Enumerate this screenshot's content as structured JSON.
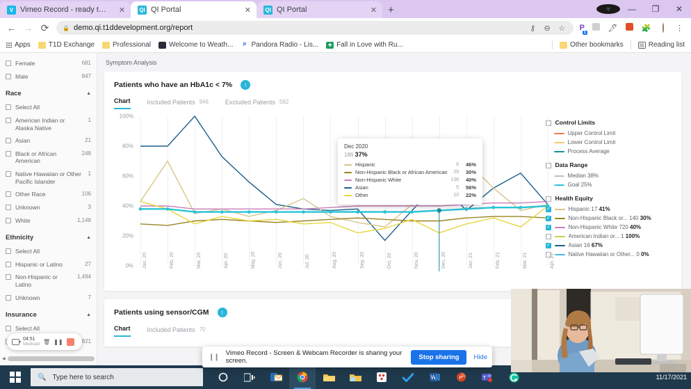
{
  "browser": {
    "tabs": [
      {
        "title": "Vimeo Record - ready to record",
        "favicon": "vimeo-icon",
        "active": false
      },
      {
        "title": "QI Portal",
        "favicon": "qi-icon",
        "active": true
      },
      {
        "title": "QI Portal",
        "favicon": "qi-icon",
        "active": false
      }
    ],
    "new_tab_label": "+",
    "close_label": "✕",
    "window_controls": {
      "minimize": "—",
      "maximize": "❐",
      "close": "✕"
    },
    "nav": {
      "back": "←",
      "forward": "→",
      "reload": "⟳"
    },
    "url": "demo.qi.t1ddevelopment.org/report",
    "url_host": "demo.qi.t1ddevelopment.org",
    "url_path": "/report",
    "lock_icon": "🔒",
    "toolbar_icons": [
      "key-icon",
      "zoom-out-icon",
      "star-icon",
      "password-manager-icon",
      "screenshot-icon",
      "highlighter-icon",
      "reader-icon",
      "extensions-icon",
      "profile-avatar",
      "menu-icon"
    ],
    "extension_badge": "1",
    "bookmarks": [
      {
        "label": "Apps",
        "icon": "apps-grid-icon"
      },
      {
        "label": "T1D Exchange",
        "icon": "folder-icon"
      },
      {
        "label": "Professional",
        "icon": "folder-icon"
      },
      {
        "label": "Welcome to Weath...",
        "icon": "weather-icon"
      },
      {
        "label": "Pandora Radio - Lis...",
        "icon": "pandora-icon"
      },
      {
        "label": "Fall in Love with Ru...",
        "icon": "sheets-icon"
      }
    ],
    "other_bookmarks": "Other bookmarks",
    "reading_list": "Reading list"
  },
  "sidebar": {
    "gender_items": [
      {
        "label": "Female",
        "count": "681",
        "checked": false
      },
      {
        "label": "Male",
        "count": "847",
        "checked": false
      }
    ],
    "sections": [
      {
        "title": "Race",
        "collapse_icon": "chevron-up-icon",
        "items": [
          {
            "label": "Select All",
            "count": "",
            "checked": false
          },
          {
            "label": "American Indian or Alaska Native",
            "count": "1",
            "checked": false
          },
          {
            "label": "Asian",
            "count": "21",
            "checked": false
          },
          {
            "label": "Black or African American",
            "count": "248",
            "checked": false
          },
          {
            "label": "Native Hawaiian or Other Pacific Islander",
            "count": "1",
            "checked": false
          },
          {
            "label": "Other Race",
            "count": "106",
            "checked": false
          },
          {
            "label": "Unknown",
            "count": "3",
            "checked": false
          },
          {
            "label": "White",
            "count": "1,148",
            "checked": false
          }
        ]
      },
      {
        "title": "Ethnicity",
        "collapse_icon": "chevron-up-icon",
        "items": [
          {
            "label": "Select All",
            "count": "",
            "checked": false
          },
          {
            "label": "Hispanic or Latino",
            "count": "27",
            "checked": false
          },
          {
            "label": "Non-Hispanic or Latino",
            "count": "1,494",
            "checked": false
          },
          {
            "label": "Unknown",
            "count": "7",
            "checked": false
          }
        ]
      },
      {
        "title": "Insurance",
        "collapse_icon": "chevron-up-icon",
        "items": [
          {
            "label": "Select All",
            "count": "",
            "checked": false
          },
          {
            "label": "Medicaid",
            "count": "821",
            "checked": false
          }
        ]
      }
    ],
    "recorder": {
      "camera_icon": "camera-icon",
      "time": "04:51",
      "sublabel": "Medicaid",
      "delete_icon": "trash-icon",
      "pause_icon": "pause-icon",
      "stop_icon": "stop-icon"
    },
    "scroll_left_icon": "scroll-left-arrow"
  },
  "main": {
    "breadcrumb": "Symptom Analysis",
    "card1": {
      "title": "Patients who have an HbA1c < 7%",
      "trend_icon": "arrow-up-badge",
      "tabs": [
        {
          "label": "Chart",
          "count": "",
          "active": true
        },
        {
          "label": "Included Patients",
          "count": "946",
          "active": false
        },
        {
          "label": "Excluded Patients",
          "count": "582",
          "active": false
        }
      ]
    },
    "card2": {
      "title": "Patients using sensor/CGM",
      "trend_icon": "arrow-up-badge",
      "tabs": [
        {
          "label": "Chart",
          "count": "",
          "active": true
        },
        {
          "label": "Included Patients",
          "count": "70",
          "active": false
        }
      ]
    }
  },
  "tooltip": {
    "date": "Dec 2020",
    "total_n": "186",
    "total_pct": "37%",
    "rows": [
      {
        "color": "#d8c58a",
        "name": "Hispanic",
        "n": "6",
        "pct": "46%"
      },
      {
        "color": "#9a8422",
        "name": "Non-Hispanic Black or African American",
        "n": "29",
        "pct": "30%"
      },
      {
        "color": "#c97db8",
        "name": "Non-Hispanic White",
        "n": "138",
        "pct": "40%"
      },
      {
        "color": "#1a5e8a",
        "name": "Asian",
        "n": "5",
        "pct": "56%"
      },
      {
        "color": "#e8d63c",
        "name": "Other",
        "n": "10",
        "pct": "22%"
      }
    ]
  },
  "legend": {
    "groups": [
      {
        "title": "Control Limits",
        "checked": false,
        "items": [
          {
            "label": "Upper Control Limit",
            "color": "#ef7b52",
            "dashed": false,
            "checked": null
          },
          {
            "label": "Lower Control Limit",
            "color": "#f6cb6a",
            "dashed": false,
            "checked": null
          },
          {
            "label": "Process Average",
            "color": "#1a8ea0",
            "dashed": false,
            "checked": null
          }
        ]
      },
      {
        "title": "Data Range",
        "checked": false,
        "items": [
          {
            "label": "Median 38%",
            "color": "#bdbdbd",
            "dashed": true,
            "checked": null
          },
          {
            "label": "Goal 25%",
            "color": "#29c4d8",
            "dashed": true,
            "checked": null
          }
        ]
      },
      {
        "title": "Health Equity",
        "checked": false,
        "items": [
          {
            "label": "Hispanic 17",
            "bold": "41%",
            "color": "#d8c58a",
            "dashed": false,
            "checked": true
          },
          {
            "label": "Non-Hispanic Black or... 140",
            "bold": "30%",
            "color": "#9a8422",
            "dashed": false,
            "checked": true
          },
          {
            "label": "Non-Hispanic White 720",
            "bold": "40%",
            "color": "#c97db8",
            "dashed": false,
            "checked": true
          },
          {
            "label": "American Indian or... 1",
            "bold": "100%",
            "color": "#c8cf4f",
            "dashed": false,
            "checked": false
          },
          {
            "label": "Asian 16",
            "bold": "67%",
            "color": "#1a5e8a",
            "dashed": false,
            "checked": true
          },
          {
            "label": "Native Hawaiian or Other... 0",
            "bold": "0%",
            "color": "#49b6e0",
            "dashed": false,
            "checked": false
          }
        ]
      }
    ]
  },
  "share_bar": {
    "grip_icon": "drag-handle-icon",
    "message": "Vimeo Record - Screen & Webcam Recorder is sharing your screen.",
    "stop_label": "Stop sharing",
    "hide_label": "Hide"
  },
  "taskbar": {
    "start_icon": "windows-logo",
    "search_icon": "search-icon",
    "search_placeholder": "Type here to search",
    "items": [
      {
        "icon": "cortana-icon"
      },
      {
        "icon": "task-view-icon"
      },
      {
        "icon": "outlook-icon"
      },
      {
        "icon": "chrome-icon",
        "active": true
      },
      {
        "icon": "file-explorer-icon"
      },
      {
        "icon": "folder-icon"
      },
      {
        "icon": "dice-app-icon"
      },
      {
        "icon": "todo-check-icon"
      },
      {
        "icon": "word-icon"
      },
      {
        "icon": "powerpoint-icon"
      },
      {
        "icon": "teams-icon"
      },
      {
        "icon": "grammarly-icon"
      }
    ],
    "clock_date": "11/17/2021"
  },
  "chart_data": {
    "type": "line",
    "title": "Patients who have an HbA1c < 7%",
    "xlabel": "",
    "ylabel": "",
    "ylim": [
      0,
      100
    ],
    "yticks": [
      0,
      20,
      40,
      60,
      80,
      100
    ],
    "ytick_labels": [
      "0%",
      "20%",
      "40%",
      "60%",
      "80%",
      "100%"
    ],
    "grid": true,
    "legend_position": "right",
    "categories": [
      "Jan, 20",
      "Feb, 20",
      "Mar, 20",
      "Apr, 20",
      "May, 20",
      "Jun, 20",
      "Jul, 20",
      "Aug, 20",
      "Sep, 20",
      "Oct, 20",
      "Nov, 20",
      "Dec, 20",
      "Jan, 21",
      "Feb, 21",
      "Mar, 21",
      "Apr, 21"
    ],
    "series": [
      {
        "name": "Asian",
        "color": "#1a5e8a",
        "values": [
          80,
          80,
          100,
          73,
          56,
          41,
          38,
          37,
          38,
          17,
          37,
          56,
          37,
          52,
          62,
          41
        ]
      },
      {
        "name": "Hispanic",
        "color": "#d8c58a",
        "values": [
          43,
          70,
          35,
          38,
          33,
          37,
          45,
          33,
          29,
          26,
          41,
          46,
          70,
          52,
          37,
          41
        ]
      },
      {
        "name": "Non-Hispanic White",
        "color": "#c97db8",
        "values": [
          40,
          40,
          38,
          38,
          38,
          38,
          38,
          39,
          40,
          40,
          40,
          40,
          41,
          42,
          42,
          43
        ]
      },
      {
        "name": "Non-Hispanic Black or African American",
        "color": "#9a8422",
        "values": [
          28,
          27,
          30,
          31,
          30,
          29,
          30,
          31,
          32,
          31,
          30,
          30,
          32,
          33,
          33,
          32
        ]
      },
      {
        "name": "Other",
        "color": "#e8d63c",
        "values": [
          43,
          38,
          28,
          33,
          30,
          31,
          28,
          29,
          22,
          25,
          31,
          22,
          28,
          32,
          26,
          40
        ]
      },
      {
        "name": "Process Average",
        "color": "#29c4d8",
        "values": [
          38,
          38,
          36,
          36,
          36,
          36,
          36,
          36,
          36,
          36,
          36,
          37,
          38,
          39,
          39,
          40
        ]
      }
    ],
    "highlight": {
      "category": "Dec, 20",
      "value": 37,
      "total": "186",
      "pct": "37%"
    }
  }
}
